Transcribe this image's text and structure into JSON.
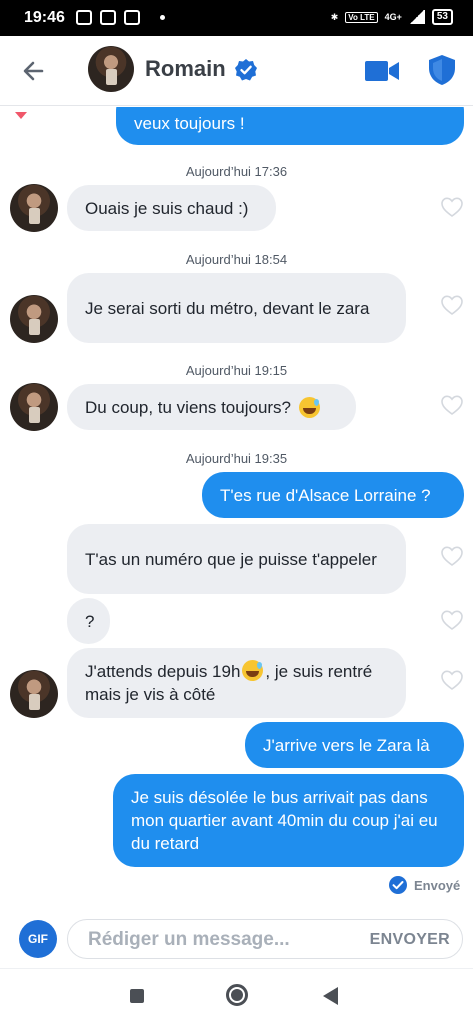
{
  "status_bar": {
    "time": "19:46",
    "network": "4G+",
    "volte": "Vo LTE",
    "battery": "53"
  },
  "header": {
    "name": "Romain",
    "verified": true
  },
  "messages": {
    "top_partial": "veux toujours !",
    "ts1": "Aujourd’hui 17:36",
    "m1": "Ouais je suis chaud :)",
    "ts2": "Aujourd’hui 18:54",
    "m2": "Je serai sorti du métro, devant le zara",
    "ts3": "Aujourd’hui 19:15",
    "m3": "Du coup, tu viens toujours?",
    "ts4": "Aujourd’hui 19:35",
    "m4": "T'es rue d'Alsace Lorraine ?",
    "m5": "T'as un numéro que je puisse t'appeler",
    "m6": "?",
    "m7_a": "J'attends depuis 19h",
    "m7_b": ", je suis rentré mais je vis à côté",
    "m8": "J'arrive vers le Zara là",
    "m9": "Je suis désolée le bus arrivait pas dans mon quartier avant 40min du coup j'ai eu du retard",
    "delivery_status": "Envoyé"
  },
  "composer": {
    "gif_label": "GIF",
    "placeholder": "Rédiger un message...",
    "send_label": "ENVOYER"
  },
  "icons": {
    "back": "arrow-left-icon",
    "verified": "verified-badge-icon",
    "video": "video-camera-icon",
    "shield": "shield-icon",
    "heart": "heart-outline-icon",
    "emoji": "sweat-smile-emoji"
  },
  "colors": {
    "accent": "#1f8eee",
    "received_bubble": "#eceef2",
    "header_icons": "#1f6fd6"
  }
}
